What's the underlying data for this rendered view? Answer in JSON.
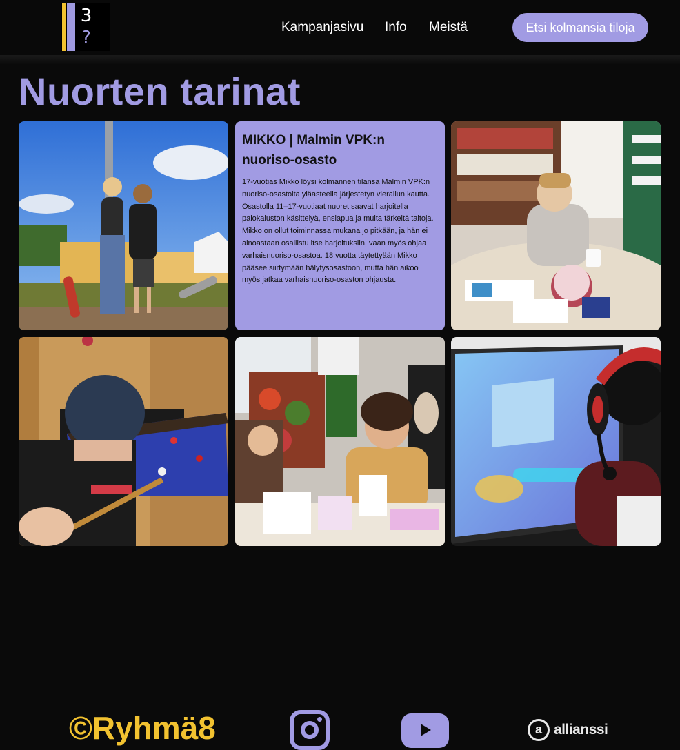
{
  "header": {
    "logo": {
      "top_glyph": "3",
      "bottom_glyph": "?",
      "colors": [
        "#f2c230",
        "#9f9ae0"
      ]
    },
    "nav": [
      {
        "label": "Kampanjasivu"
      },
      {
        "label": "Info"
      },
      {
        "label": "Meistä"
      }
    ],
    "cta_label": "Etsi kolmansia tiloja"
  },
  "page_title": "Nuorten tarinat",
  "story": {
    "title": "MIKKO | Malmin VPK:n nuoriso-osasto",
    "body": "17-vuotias Mikko löysi kolmannen tilansa Malmin VPK:n nuoriso-osastolta yläasteella järjestetyn vierailun kautta. Osastolla 11–17-vuotiaat nuoret saavat harjoitella palokaluston käsittelyä, ensiapua ja muita tärkeitä taitoja. Mikko on ollut toiminnassa mukana jo pitkään, ja hän ei ainoastaan osallistu itse harjoituksiin, vaan myös ohjaa varhaisnuoriso-osastoa. 18 vuotta täytettyään Mikko pääsee siirtymään hälytysosastoon, mutta hän aikoo myös jatkaa varhaisnuoriso-osaston ohjausta."
  },
  "tiles": [
    {
      "name": "photo-skateboarders"
    },
    {
      "name": "story-card-mikko"
    },
    {
      "name": "photo-library-table"
    },
    {
      "name": "photo-pool-player"
    },
    {
      "name": "photo-art-table"
    },
    {
      "name": "photo-gamer"
    }
  ],
  "footer": {
    "brand": "©Ryhmä8",
    "icons": [
      "instagram-icon",
      "youtube-icon",
      "allianssi-logo"
    ],
    "allianssi": {
      "mark": "a",
      "word": "allianssi"
    }
  },
  "colors": {
    "accent": "#a19be3",
    "brand_yellow": "#f2c230",
    "background": "#0a0a0a"
  }
}
